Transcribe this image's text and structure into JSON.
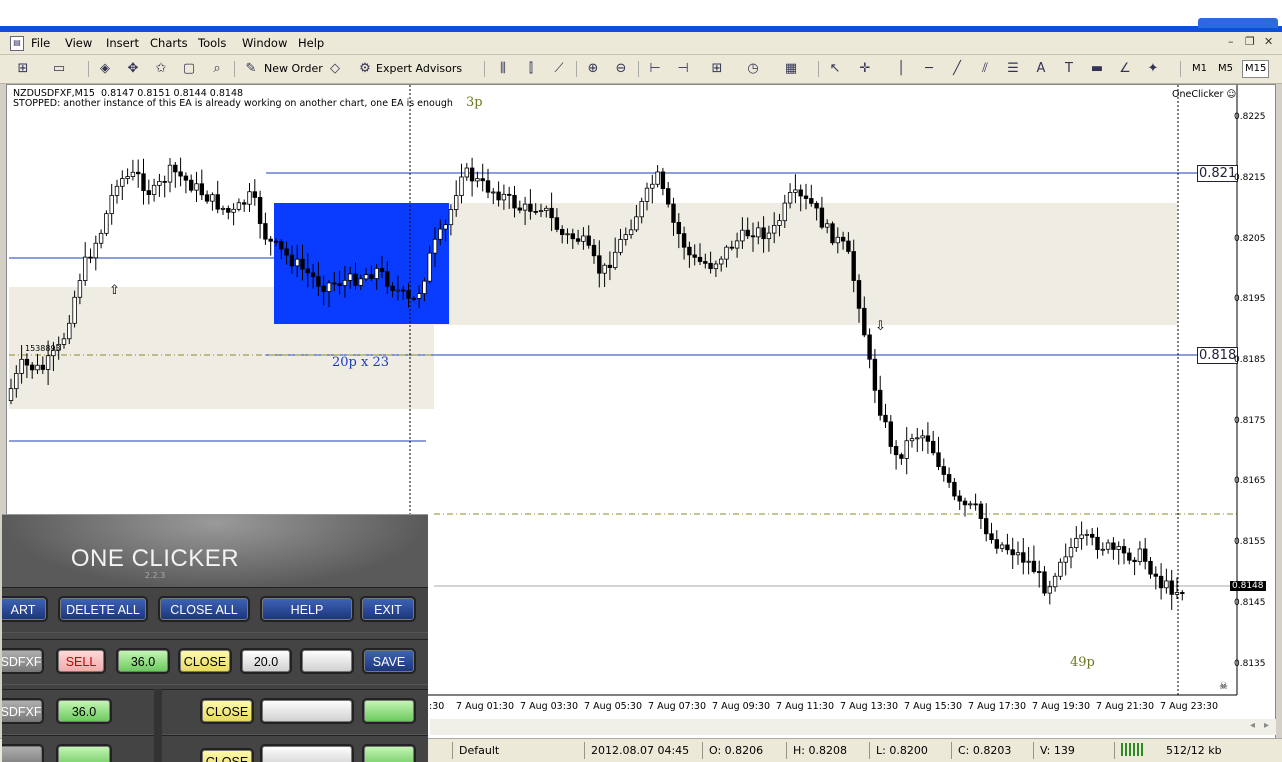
{
  "menu": {
    "items": [
      "File",
      "View",
      "Insert",
      "Charts",
      "Tools",
      "Window",
      "Help"
    ]
  },
  "toolbar": {
    "new_order_label": "New Order",
    "expert_advisors_label": "Expert Advisors",
    "timeframes": [
      "M1",
      "M5",
      "M15"
    ],
    "active_timeframe": "M15"
  },
  "chart": {
    "symbol_line": "NZDUSDFXF,M15  0.8147 0.8151 0.8144 0.8148",
    "status_line": "STOPPED: another instance of this EA is already working on another chart, one EA is enough",
    "oneclicker_tag": "OneClicker",
    "label_3p": "3p",
    "label_49p": "49p",
    "box_label": "20p x 23",
    "level_tags": [
      "0.821",
      "0.818"
    ],
    "tiny_label": "1538893",
    "current_price": "0.8148",
    "price_ticks": [
      "0.8225",
      "0.8215",
      "0.8205",
      "0.8195",
      "0.8185",
      "0.8175",
      "0.8165",
      "0.8155",
      "0.8145",
      "0.8135"
    ],
    "time_ticks": [
      ":30",
      "7 Aug 01:30",
      "7 Aug 03:30",
      "7 Aug 05:30",
      "7 Aug 07:30",
      "7 Aug 09:30",
      "7 Aug 11:30",
      "7 Aug 13:30",
      "7 Aug 15:30",
      "7 Aug 17:30",
      "7 Aug 19:30",
      "7 Aug 21:30",
      "7 Aug 23:30"
    ]
  },
  "panel": {
    "title": "ONE CLICKER",
    "version": "2.2.3",
    "row1": [
      "ART",
      "DELETE ALL",
      "CLOSE ALL",
      "HELP",
      "EXIT"
    ],
    "row2": {
      "symbol": "SDFXF",
      "sell": "SELL",
      "lot": "36.0",
      "close": "CLOSE",
      "value": "20.0",
      "save": "SAVE"
    },
    "row3": {
      "symbol": "SDFXF",
      "lot": "36.0",
      "close": "CLOSE"
    },
    "row4": {
      "close": "CLOSE"
    }
  },
  "status": {
    "profile": "Default",
    "datetime": "2012.08.07 04:45",
    "open": "O: 0.8206",
    "high": "H: 0.8208",
    "low": "L: 0.8200",
    "close": "C: 0.8203",
    "volume": "V: 139",
    "traffic": "512/12 kb"
  },
  "colors": {
    "box_blue": "#0a3cff",
    "zone_beige": "#efede3",
    "level_line": "#1a3fb8",
    "dashdot": "#8a8a2a"
  }
}
